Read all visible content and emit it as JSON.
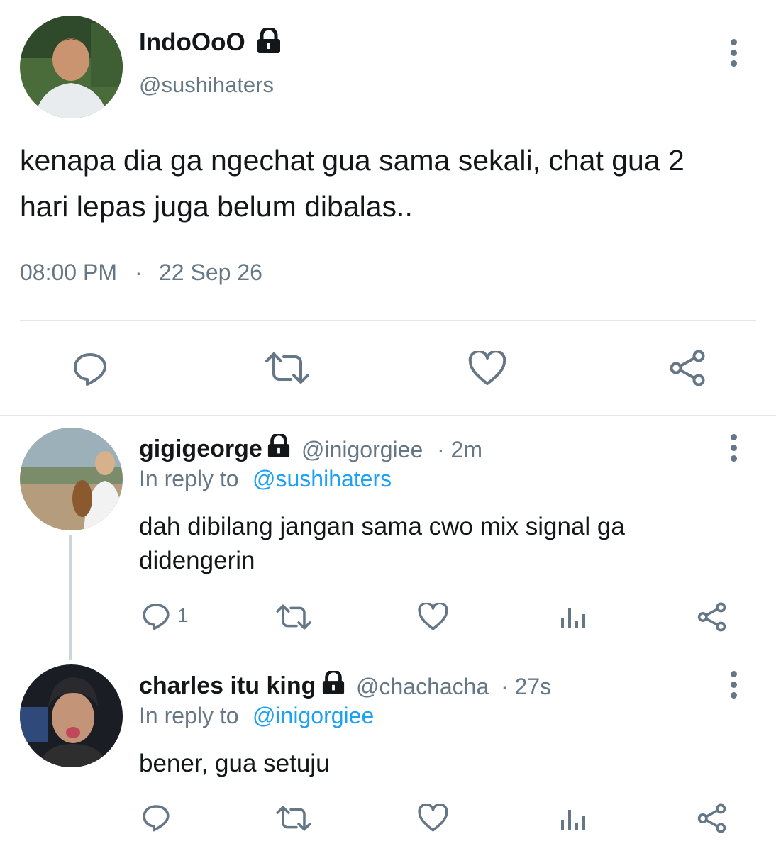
{
  "main_tweet": {
    "display_name": "IndoOoO",
    "handle": "@sushihaters",
    "text_line1": "kenapa dia ga ngechat gua sama sekali, chat gua 2",
    "text_line2": "hari lepas juga belum dibalas..",
    "time": "08:00 PM",
    "separator": "·",
    "date": "22 Sep 26",
    "avatar_icon": "avatar-photo",
    "protected_icon": "lock-icon"
  },
  "actions": {
    "reply_icon": "reply-icon",
    "retweet_icon": "retweet-icon",
    "like_icon": "heart-icon",
    "share_icon": "share-icon",
    "analytics_icon": "analytics-icon"
  },
  "replies": [
    {
      "display_name": "gigigeorge",
      "handle": "@inigorgiee",
      "age": "· 2m",
      "in_reply_prefix": "In reply to",
      "in_reply_handle": "@sushihaters",
      "text_line1": "dah dibilang jangan sama cwo mix signal ga",
      "text_line2": "didengerin",
      "reply_count": "1"
    },
    {
      "display_name": "charles itu king",
      "handle": "@chachacha",
      "age": "· 27s",
      "in_reply_prefix": "In reply to",
      "in_reply_handle": "@inigorgiee",
      "text_line1": "bener, gua setuju",
      "reply_count": ""
    }
  ],
  "colors": {
    "text": "#14171a",
    "secondary": "#657786",
    "accent": "#1da1f2",
    "divider": "#e1e8ed"
  }
}
